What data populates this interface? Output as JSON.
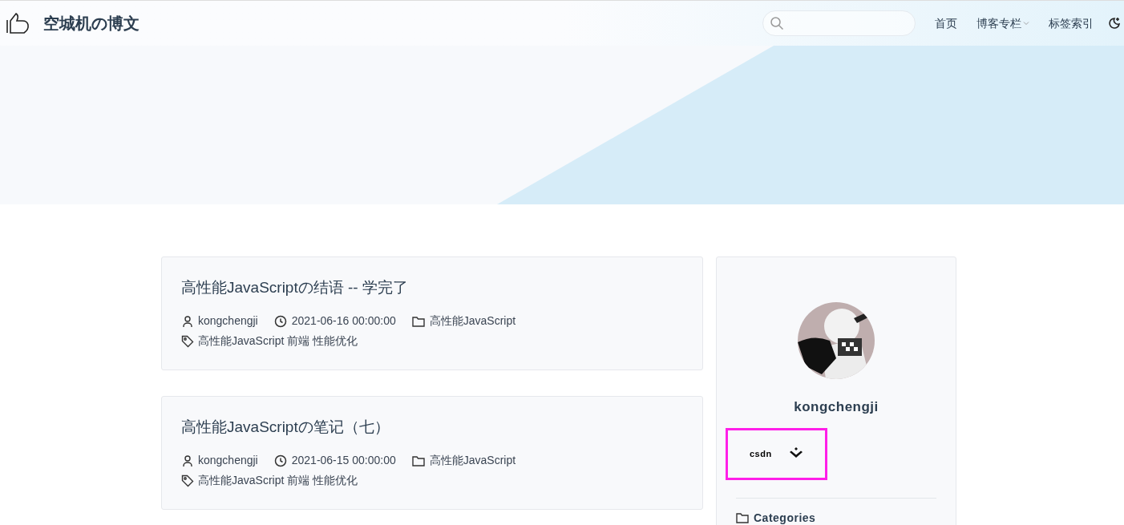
{
  "header": {
    "site_title": "空城机の博文",
    "nav": [
      {
        "label": "首页",
        "dropdown": false
      },
      {
        "label": "博客专栏",
        "dropdown": true
      },
      {
        "label": "标签索引",
        "dropdown": false
      }
    ]
  },
  "posts": [
    {
      "title": "高性能JavaScriptの结语 -- 学完了",
      "author": "kongchengji",
      "date": "2021-06-16 00:00:00",
      "category": "高性能JavaScript",
      "tags": [
        "高性能JavaScript",
        "前端",
        "性能优化"
      ]
    },
    {
      "title": "高性能JavaScriptの笔记（七）",
      "author": "kongchengji",
      "date": "2021-06-15 00:00:00",
      "category": "高性能JavaScript",
      "tags": [
        "高性能JavaScript",
        "前端",
        "性能优化"
      ]
    }
  ],
  "profile": {
    "name": "kongchengji",
    "links": [
      {
        "kind": "text",
        "label": "csdn"
      },
      {
        "kind": "icon"
      }
    ],
    "highlighted": true,
    "section_title": "Categories"
  }
}
